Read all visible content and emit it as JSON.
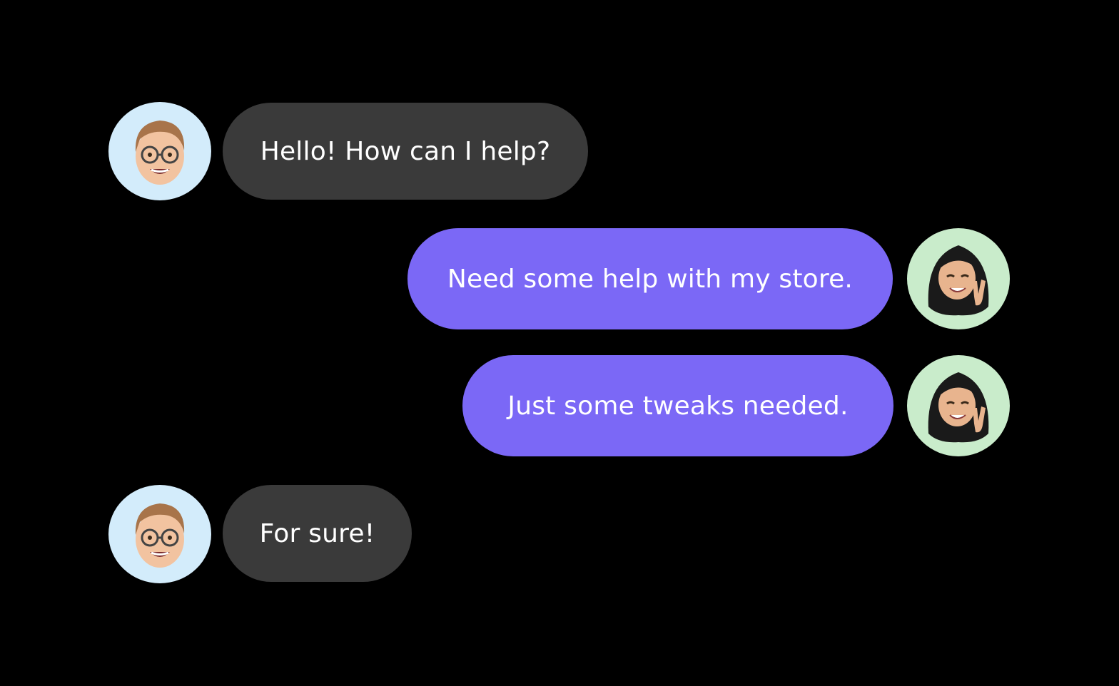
{
  "colors": {
    "background": "#000000",
    "agent_bubble": "#3a3a3a",
    "user_bubble": "#7b68f6",
    "text": "#ffffff",
    "agent_avatar_bg": "#d3ecfb",
    "user_avatar_bg": "#c9eccb"
  },
  "messages": [
    {
      "sender": "agent",
      "avatar": "memoji-man-glasses-icon",
      "text": "Hello! How can I help?"
    },
    {
      "sender": "user",
      "avatar": "memoji-woman-peace-sign-icon",
      "text": "Need some help with my store."
    },
    {
      "sender": "user",
      "avatar": "memoji-woman-peace-sign-icon",
      "text": "Just some tweaks needed."
    },
    {
      "sender": "agent",
      "avatar": "memoji-man-glasses-icon",
      "text": "For sure!"
    }
  ]
}
